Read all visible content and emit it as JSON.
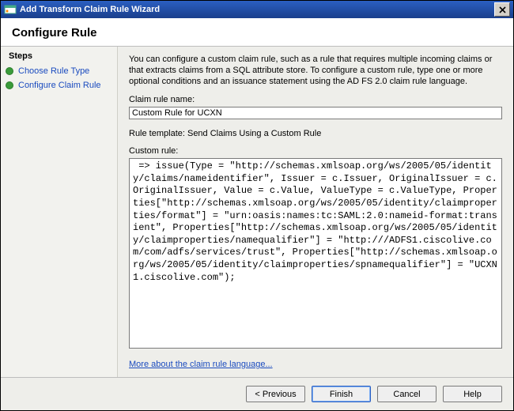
{
  "window": {
    "title": "Add Transform Claim Rule Wizard"
  },
  "header": {
    "heading": "Configure Rule"
  },
  "sidebar": {
    "title": "Steps",
    "items": [
      {
        "label": "Choose Rule Type"
      },
      {
        "label": "Configure Claim Rule"
      }
    ]
  },
  "content": {
    "instructions": "You can configure a custom claim rule, such as a rule that requires multiple incoming claims or that extracts claims from a SQL attribute store. To configure a custom rule, type one or more optional conditions and an issuance statement using the AD FS 2.0 claim rule language.",
    "claim_rule_name_label": "Claim rule name:",
    "claim_rule_name_value": "Custom Rule for UCXN",
    "rule_template_text": "Rule template: Send Claims Using a Custom Rule",
    "custom_rule_label": "Custom rule:",
    "custom_rule_value": " => issue(Type = \"http://schemas.xmlsoap.org/ws/2005/05/identity/claims/nameidentifier\", Issuer = c.Issuer, OriginalIssuer = c.OriginalIssuer, Value = c.Value, ValueType = c.ValueType, Properties[\"http://schemas.xmlsoap.org/ws/2005/05/identity/claimproperties/format\"] = \"urn:oasis:names:tc:SAML:2.0:nameid-format:transient\", Properties[\"http://schemas.xmlsoap.org/ws/2005/05/identity/claimproperties/namequalifier\"] = \"http:///ADFS1.ciscolive.com/com/adfs/services/trust\", Properties[\"http://schemas.xmlsoap.org/ws/2005/05/identity/claimproperties/spnamequalifier\"] = \"UCXN1.ciscolive.com\");",
    "link_text": "More about the claim rule language..."
  },
  "footer": {
    "previous": "< Previous",
    "finish": "Finish",
    "cancel": "Cancel",
    "help": "Help"
  }
}
